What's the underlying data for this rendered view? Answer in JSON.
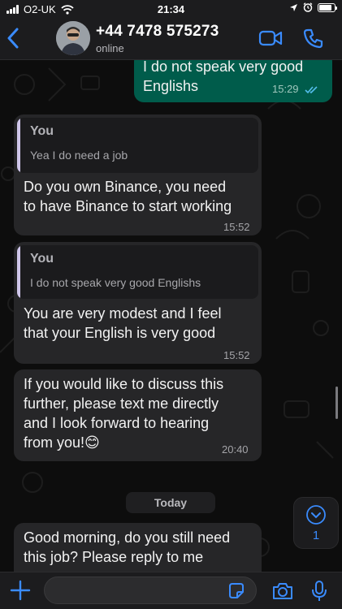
{
  "status_bar": {
    "carrier": "O2-UK",
    "time": "21:34"
  },
  "header": {
    "contact_name": "+44 7478 575273",
    "status": "online"
  },
  "messages": [
    {
      "direction": "out",
      "text_lines": [
        "I do not speak very good",
        "Englishs"
      ],
      "time": "15:29",
      "read": true
    },
    {
      "direction": "in",
      "quote": {
        "author": "You",
        "text": "Yea I do need a job"
      },
      "text_lines": [
        "Do you own Binance, you need",
        "to have Binance to start working"
      ],
      "time": "15:52"
    },
    {
      "direction": "in",
      "quote": {
        "author": "You",
        "text": "I do not speak very good Englishs"
      },
      "text_lines": [
        "You are very modest and I feel",
        "that your English is very good"
      ],
      "time": "15:52"
    },
    {
      "direction": "in",
      "text_lines": [
        "If you would like to discuss this",
        "further, please text me directly",
        "and I look forward to hearing",
        "from you!"
      ],
      "emoji": "😊",
      "time": "20:40"
    },
    {
      "direction": "in",
      "text_lines": [
        "Good morning, do you still need",
        "this job? Please reply to me"
      ]
    }
  ],
  "date_separator": "Today",
  "scroll_button": {
    "unread_count": "1"
  },
  "composer": {
    "placeholder": ""
  },
  "colors": {
    "accent": "#3a8bfd",
    "outgoing_bubble": "#005c4b",
    "incoming_bubble": "#262628",
    "read_ticks": "#53bdeb"
  },
  "icons": [
    "back-chevron-icon",
    "video-call-icon",
    "phone-icon",
    "plus-icon",
    "sticker-icon",
    "camera-icon",
    "microphone-icon",
    "chevron-down-icon",
    "wifi-icon",
    "location-icon",
    "alarm-icon",
    "battery-icon"
  ]
}
